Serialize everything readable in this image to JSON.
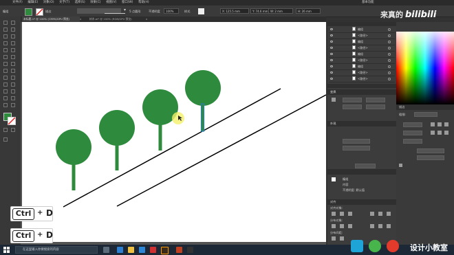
{
  "menubar": {
    "items": [
      "文件(F)",
      "编辑(E)",
      "对象(O)",
      "文字(T)",
      "选择(S)",
      "效果(C)",
      "视图(V)",
      "窗口(W)",
      "帮助(H)"
    ],
    "right_label": "基本功能"
  },
  "control_bar": {
    "stroke_label": "描边",
    "stroke_value": "",
    "profile_label": "5 点圆形",
    "opacity_label": "不透明度",
    "opacity_value": "100%",
    "style_label": "样式",
    "x_value": "X: 125.5 mm",
    "y_value": "Y: 74.6 mm",
    "w_value": "W: 2 mm",
    "h_value": "H: 26 mm"
  },
  "tabs": [
    {
      "label": "未标题-1* @ 100% (CMYK/GPU 预览)"
    },
    {
      "label": "x"
    },
    {
      "label": "树木.ai* @ 100% (RGB/GPU 预览)"
    },
    {
      "label": "x"
    }
  ],
  "layers_panel": {
    "rows": [
      {
        "label": "编组"
      },
      {
        "label": "<路径>"
      },
      {
        "label": "编组"
      },
      {
        "label": "<路径>"
      },
      {
        "label": "编组"
      },
      {
        "label": "<路径>"
      },
      {
        "label": "编组"
      },
      {
        "label": "<路径>"
      },
      {
        "label": "<路径>"
      }
    ]
  },
  "transform_panel": {
    "title": "变换"
  },
  "appearance_panel": {
    "title": "外观",
    "rows": [
      "编组",
      "内容",
      "不透明度: 默认值"
    ]
  },
  "align_panel": {
    "title": "对齐",
    "sub": [
      "对齐对象:",
      "分布对象:",
      "分布间距:"
    ]
  },
  "stroke_panel": {
    "title": "描边",
    "weight_label": "粗细:",
    "weight_value": "0 pt"
  },
  "artwork": {
    "tree_color": "#2e8b3d",
    "trunk_color": "#2e8b3d",
    "selected_trunk_color": "#2a7db5",
    "line_color": "#000000"
  },
  "key_hints": [
    {
      "ctrl": "Ctrl",
      "plus": "+",
      "key": "D"
    },
    {
      "ctrl": "Ctrl",
      "plus": "+",
      "key": "D"
    }
  ],
  "taskbar": {
    "search_placeholder": "在这里输入你要搜索的内容"
  },
  "watermark": {
    "prefix": "来真的",
    "brand": "bilibili",
    "channel": "设计小教室"
  }
}
